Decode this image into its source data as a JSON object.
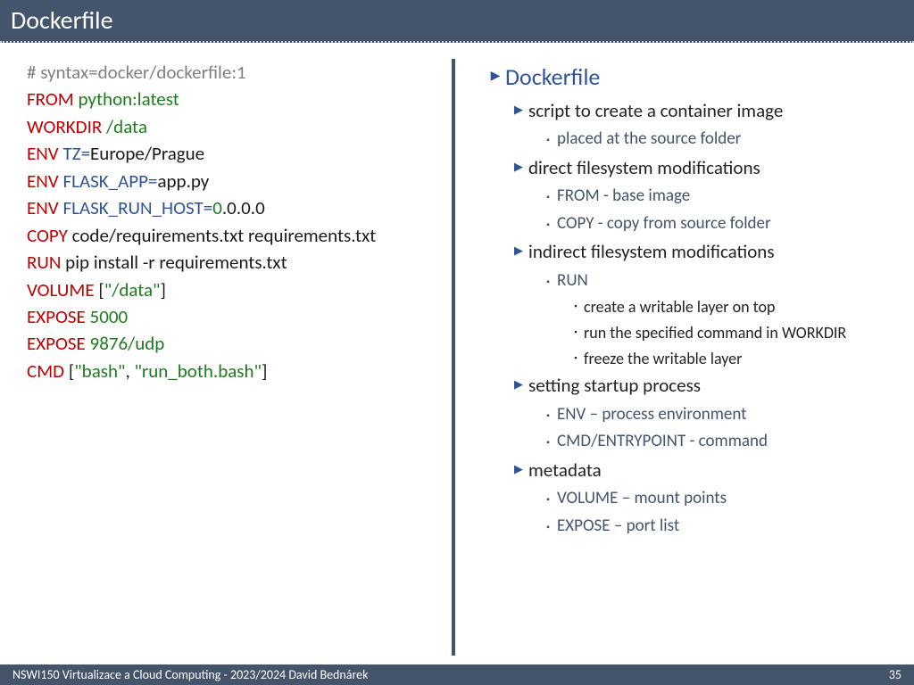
{
  "header": {
    "title": "Dockerfile"
  },
  "code": {
    "l0": "# syntax=docker/dockerfile:1",
    "l1_k": "FROM",
    "l1_v": " python:latest",
    "l2_k": "WORKDIR",
    "l2_v": " /data",
    "l3_k": "ENV",
    "l3_n": " TZ",
    "l3_e": "=",
    "l3_v": "Europe/Prague",
    "l4_k": "ENV",
    "l4_n": " FLASK_APP",
    "l4_e": "=",
    "l4_v": "app.py",
    "l5_k": "ENV",
    "l5_n": " FLASK_RUN_HOST",
    "l5_e": "=",
    "l5_g": "0",
    "l5_v": ".0.0.0",
    "l6_k": "COPY",
    "l6_v": " code/requirements.txt requirements.txt",
    "l7_k": "RUN",
    "l7_v": " pip install -r requirements.txt",
    "l8_k": "VOLUME",
    "l8_a": " [",
    "l8_s": "\"/data\"",
    "l8_b": "]",
    "l9_k": "EXPOSE",
    "l9_v": " 5000",
    "l10_k": "EXPOSE",
    "l10_v": " 9876/udp",
    "l11_k": "CMD",
    "l11_a": " [",
    "l11_s1": "\"bash\"",
    "l11_c": ", ",
    "l11_s2": "\"run_both.bash\"",
    "l11_b": "]"
  },
  "outline": {
    "title": "Dockerfile",
    "i1": "script to create a container image",
    "i1_1": "placed at the source folder",
    "i2": "direct filesystem modifications",
    "i2_1": "FROM - base image",
    "i2_2": "COPY - copy from source folder",
    "i3": "indirect filesystem modifications",
    "i3_1": "RUN",
    "i3_1_1": "create a writable layer on top",
    "i3_1_2": "run the specified command in WORKDIR",
    "i3_1_3": "freeze the writable layer",
    "i4": "setting startup process",
    "i4_1": "ENV – process environment",
    "i4_2": "CMD/ENTRYPOINT - command",
    "i5": "metadata",
    "i5_1": "VOLUME – mount points",
    "i5_2": "EXPOSE – port list"
  },
  "footer": {
    "text": "NSWI150 Virtualizace a Cloud Computing - 2023/2024 David Bednárek",
    "page": "35"
  }
}
